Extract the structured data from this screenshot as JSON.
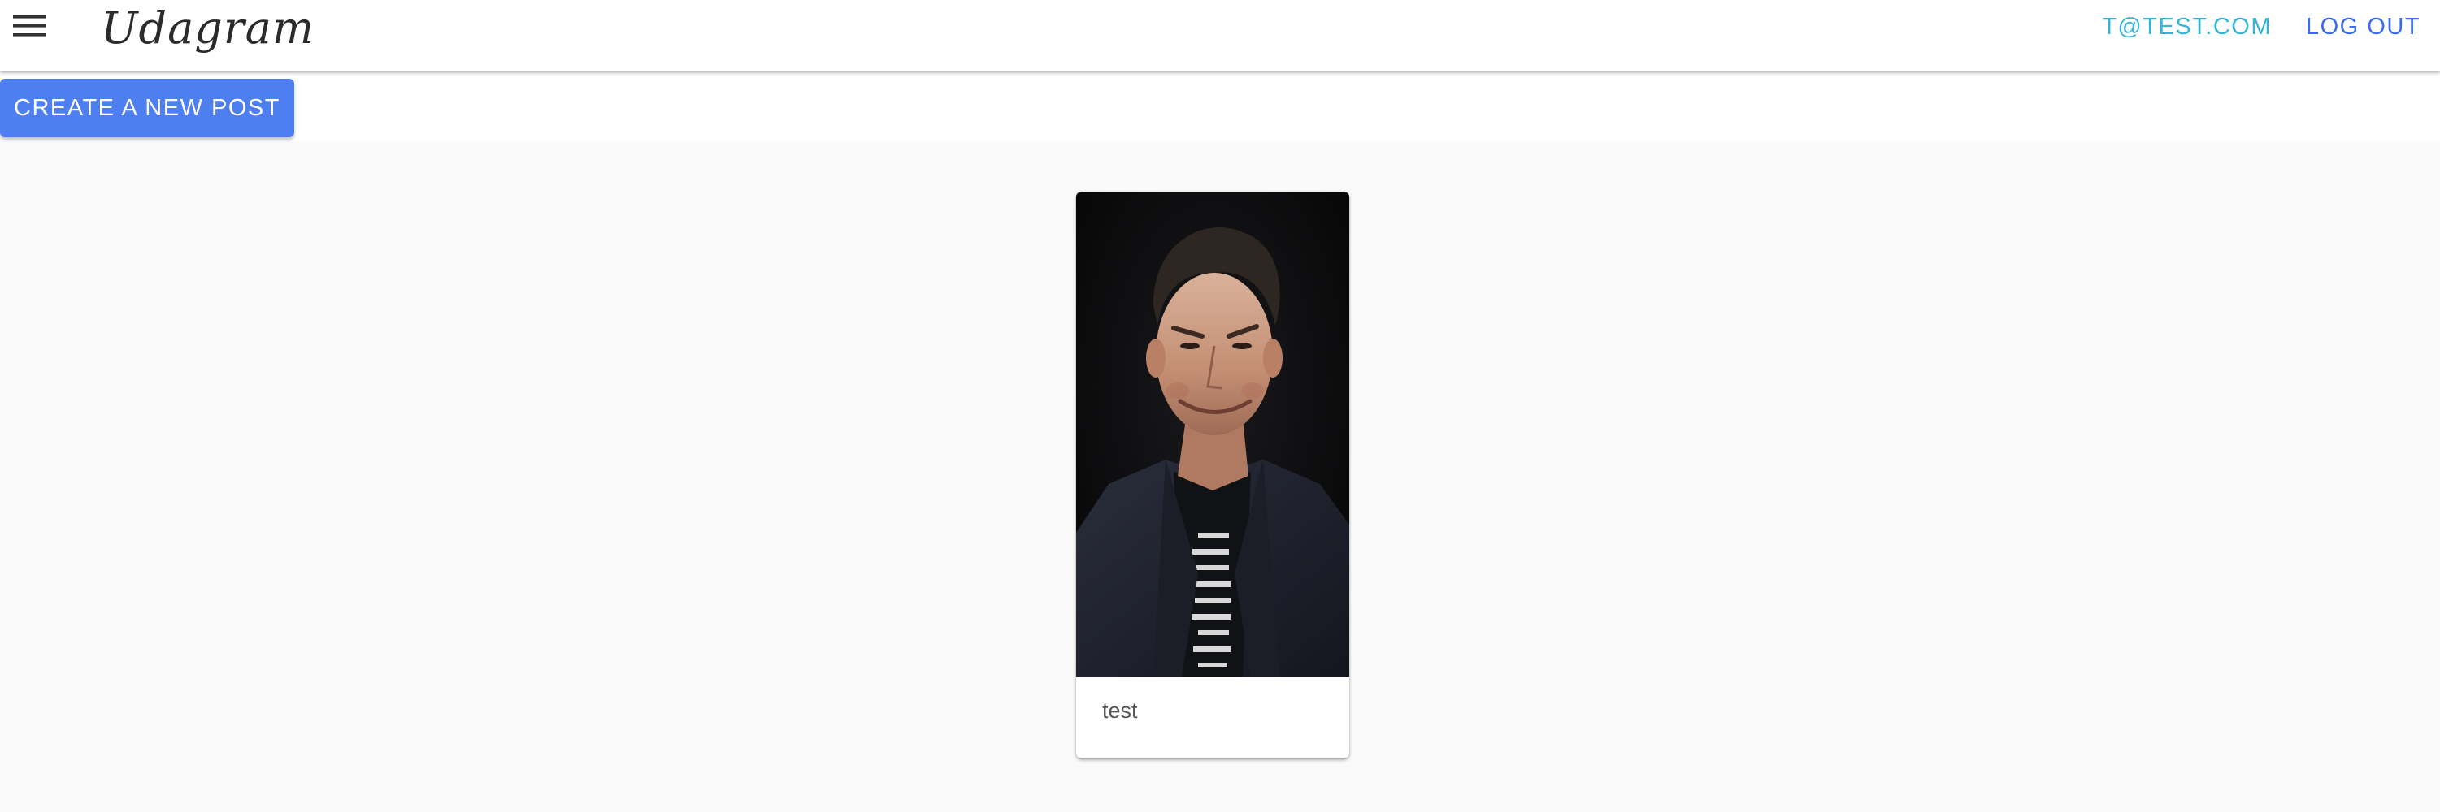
{
  "header": {
    "logo": "Udagram",
    "menu_icon": "hamburger-menu-icon",
    "user_email": "T@TEST.COM",
    "logout_label": "LOG OUT"
  },
  "actions": {
    "create_post_label": "CREATE A NEW POST"
  },
  "feed": {
    "posts": [
      {
        "caption": "test",
        "image": "portrait photo of a grimacing man in dark jacket"
      }
    ]
  },
  "colors": {
    "accent": "#4e7ff0",
    "email": "#34b5d6",
    "logout": "#3b6cf0",
    "background": "#fafafa"
  }
}
